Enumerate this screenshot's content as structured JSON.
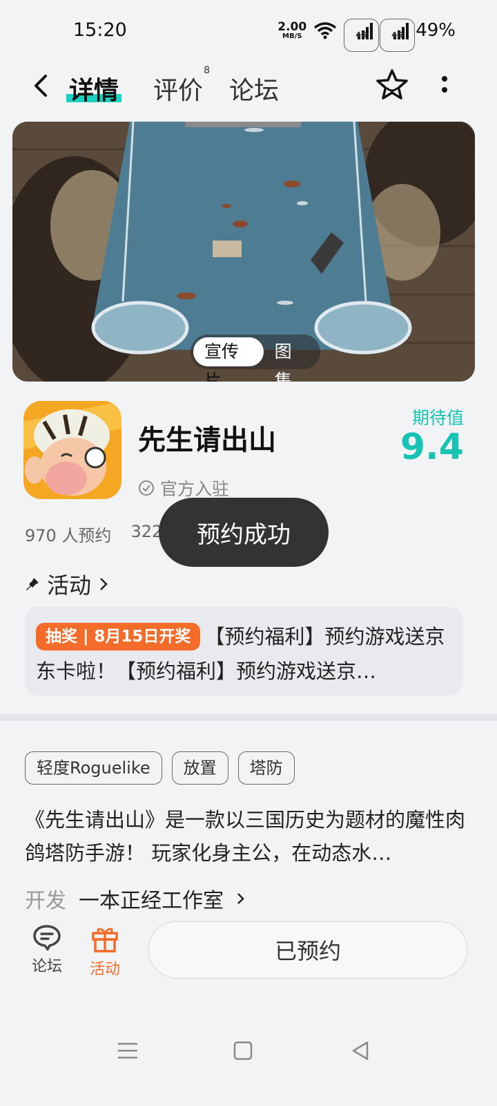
{
  "status": {
    "time": "15:20",
    "net_speed_value": "2.00",
    "net_speed_unit": "MB/S",
    "signal1_label": "4G",
    "signal2_label": "4G",
    "battery": "49%"
  },
  "nav": {
    "tab_detail": "详情",
    "tab_review": "评价",
    "review_count": "8",
    "tab_forum": "论坛"
  },
  "banner": {
    "toggle_video": "宣传片",
    "toggle_gallery": "图集"
  },
  "game": {
    "name": "先生请出山",
    "official": "官方入驻",
    "expect_label": "期待值",
    "expect_score": "9.4",
    "reservations": "970 人预约",
    "second_stat": "322"
  },
  "toast": "预约成功",
  "activity": {
    "heading": "活动",
    "badge": "抽奖 | 8月15日开奖",
    "text": "【预约福利】预约游戏送京东卡啦！【预约福利】预约游戏送京…"
  },
  "tags": [
    "轻度Roguelike",
    "放置",
    "塔防"
  ],
  "description": "《先生请出山》是一款以三国历史为题材的魔性肉鸽塔防手游！ 玩家化身主公，在动态水…",
  "developer": {
    "label": "开发",
    "name": "一本正经工作室"
  },
  "bottom": {
    "forum": "论坛",
    "activity": "活动",
    "reserved": "已预约"
  },
  "colors": {
    "accent": "#17c3b2",
    "orange": "#f36c2a",
    "background": "#f2f3f5"
  }
}
